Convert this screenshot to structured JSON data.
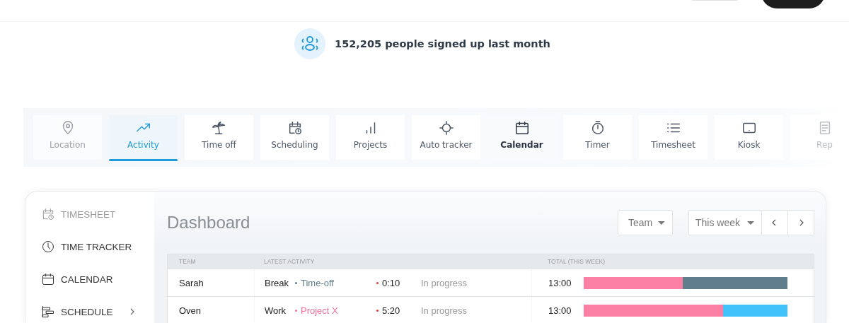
{
  "banner": {
    "text": "152,205 people signed up last month"
  },
  "features": [
    {
      "label": "Location",
      "kind": "faded",
      "selected": false
    },
    {
      "label": "Activity",
      "kind": "normal",
      "selected": true
    },
    {
      "label": "Time off",
      "kind": "normal",
      "selected": false
    },
    {
      "label": "Scheduling",
      "kind": "normal",
      "selected": false
    },
    {
      "label": "Projects",
      "kind": "normal",
      "selected": false
    },
    {
      "label": "Auto tracker",
      "kind": "normal",
      "selected": false
    },
    {
      "label": "Calendar",
      "kind": "strong",
      "selected": false
    },
    {
      "label": "Timer",
      "kind": "normal",
      "selected": false
    },
    {
      "label": "Timesheet",
      "kind": "normal",
      "selected": false
    },
    {
      "label": "Kiosk",
      "kind": "normal",
      "selected": false
    },
    {
      "label": "Rep",
      "kind": "cut",
      "selected": false
    }
  ],
  "sidebar": {
    "items": [
      {
        "label": "TIMESHEET",
        "kind": "faded",
        "expandable": false
      },
      {
        "label": "TIME TRACKER",
        "kind": "normal",
        "expandable": false
      },
      {
        "label": "CALENDAR",
        "kind": "normal",
        "expandable": false
      },
      {
        "label": "SCHEDULE",
        "kind": "normal",
        "expandable": true
      }
    ]
  },
  "dashboard": {
    "title": "Dashboard",
    "filters": [
      {
        "value": "Team"
      },
      {
        "value": "This week"
      }
    ],
    "columns": [
      "TEAM",
      "LATEST ACTIVITY",
      "TOTAL (THIS WEEK)"
    ],
    "rows": [
      {
        "name": "Sarah",
        "activity": "Break",
        "tag": "Time-off",
        "color": "#607d8b",
        "time": "0:10",
        "status": "In progress",
        "total": "13:00",
        "segments": [
          {
            "color": "#fb7fa4",
            "level": 0.485
          },
          {
            "color": "#607d8b",
            "level": 0.515
          }
        ]
      },
      {
        "name": "Oven",
        "activity": "Work",
        "tag": "Project X",
        "color": "#f06f9b",
        "time": "5:20",
        "status": "In progress",
        "total": "13:00",
        "segments": [
          {
            "color": "#fb7fa4",
            "level": 0.685
          },
          {
            "color": "#41c2fa",
            "level": 0.315
          }
        ]
      }
    ]
  }
}
